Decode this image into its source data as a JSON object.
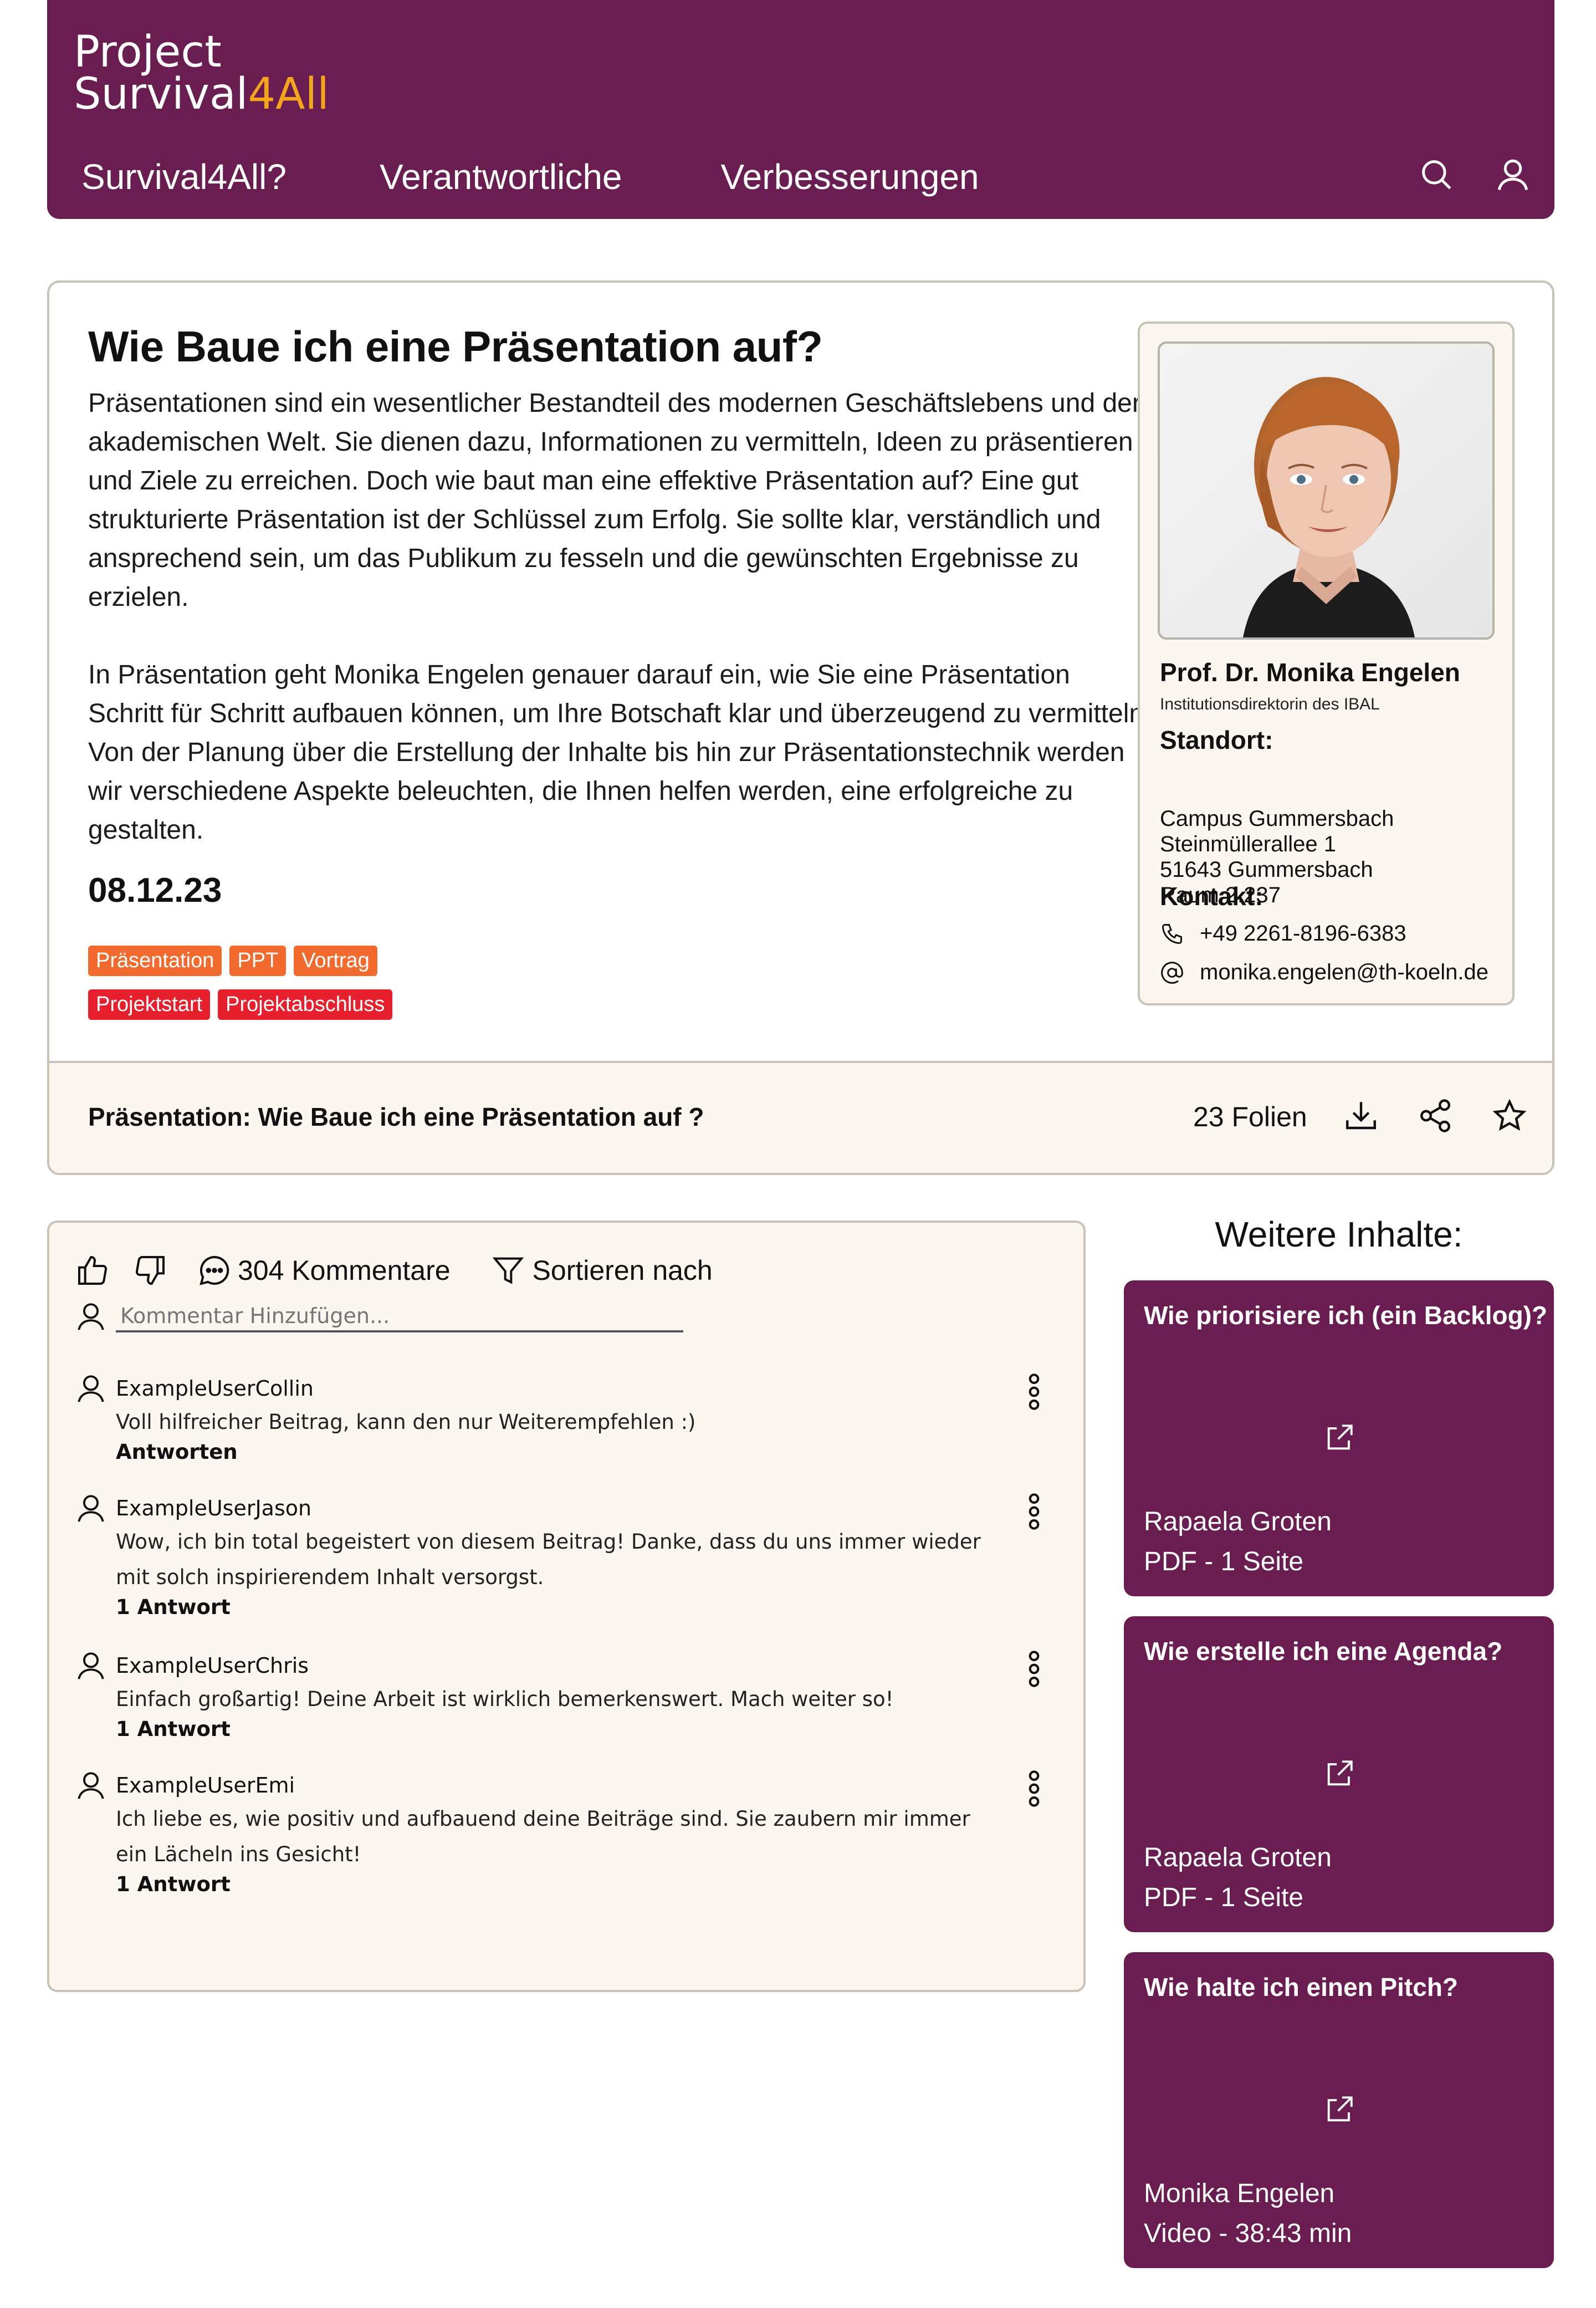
{
  "header": {
    "logo_line1": "Project",
    "logo_line2_main": "Survival",
    "logo_line2_accent": "4All",
    "nav": [
      "Survival4All?",
      "Verantwortliche",
      "Verbesserungen"
    ]
  },
  "article": {
    "title": "Wie Baue ich eine Präsentation auf?",
    "paragraph1": "Präsentationen sind ein wesentlicher Bestandteil des modernen Geschäftslebens und der akademischen Welt. Sie dienen dazu, Informationen zu vermitteln, Ideen zu präsentieren und Ziele zu erreichen. Doch wie baut man eine effektive Präsentation auf? Eine gut strukturierte Präsentation ist der Schlüssel zum Erfolg. Sie sollte klar, verständlich und ansprechend sein, um das Publikum zu fesseln und die gewünschten Ergebnisse zu erzielen.",
    "paragraph2": "In Präsentation geht Monika Engelen genauer darauf ein, wie Sie eine Präsentation Schritt für Schritt aufbauen können, um Ihre Botschaft klar und überzeugend zu vermitteln. Von der Planung über die Erstellung der Inhalte bis hin zur Präsentationstechnik werden wir verschiedene Aspekte beleuchten, die Ihnen helfen werden, eine erfolgreiche   zu gestalten.",
    "date": "08.12.23",
    "tags_row1": [
      "Präsentation",
      "PPT",
      "Vortrag"
    ],
    "tags_row2": [
      "Projektstart",
      "Projektabschluss"
    ]
  },
  "profile": {
    "name": "Prof. Dr. Monika Engelen",
    "role": "Institutionsdirektorin des IBAL",
    "location_heading": "Standort:",
    "address": [
      "Campus Gummersbach",
      "Steinmüllerallee 1",
      "51643 Gummersbach",
      "Raum 2.237"
    ],
    "contact_heading": "Kontakt:",
    "phone": "+49 2261-8196-6383",
    "email": "monika.engelen@th-koeln.de"
  },
  "file_bar": {
    "title": "Präsentation: Wie Baue ich eine Präsentation auf ?",
    "slides": "23 Folien"
  },
  "comments": {
    "count_label": "304 Kommentare",
    "sort_label": "Sortieren nach",
    "input_placeholder": "Kommentar Hinzufügen...",
    "items": [
      {
        "user": "ExampleUserCollin",
        "text": "Voll hilfreicher Beitrag, kann den nur Weiterempfehlen :)",
        "reply": "Antworten"
      },
      {
        "user": "ExampleUserJason",
        "text": "Wow, ich bin total begeistert von diesem Beitrag! Danke, dass du uns immer wieder mit solch inspirierendem Inhalt versorgst.",
        "reply": "1 Antwort"
      },
      {
        "user": "ExampleUserChris",
        "text": "Einfach großartig! Deine Arbeit ist wirklich bemerkenswert. Mach weiter so!",
        "reply": "1 Antwort"
      },
      {
        "user": "ExampleUserEmi",
        "text": "Ich liebe es, wie positiv und aufbauend deine Beiträge sind. Sie zaubern mir immer ein Lächeln ins Gesicht!",
        "reply": "1 Antwort"
      }
    ]
  },
  "sidebar": {
    "heading": "Weitere Inhalte:",
    "cards": [
      {
        "title": "Wie priorisiere ich (ein Backlog)?",
        "author": "Rapaela Groten",
        "meta": "PDF - 1 Seite"
      },
      {
        "title": "Wie erstelle ich eine Agenda?",
        "author": "Rapaela Groten",
        "meta": "PDF - 1 Seite"
      },
      {
        "title": "Wie halte ich einen Pitch?",
        "author": "Monika Engelen",
        "meta": "Video - 38:43 min"
      }
    ]
  },
  "colors": {
    "brand": "#6a1d50",
    "accent": "#f3a51b",
    "tag_orange": "#f26a2e",
    "tag_red": "#e8202e",
    "panel_bg": "#fbf6ef"
  }
}
